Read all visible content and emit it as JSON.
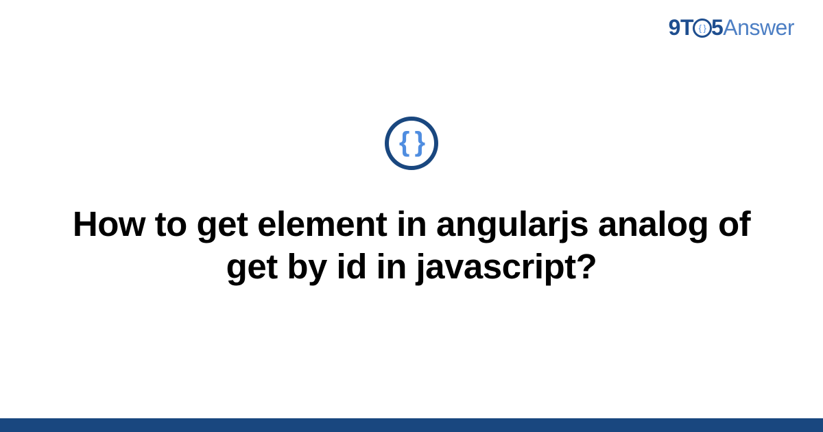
{
  "logo": {
    "part_9t": "9T",
    "circle_inner": "{ }",
    "part_5": "5",
    "part_answer": "Answer"
  },
  "category": {
    "icon_glyph": "{ }",
    "icon_name": "code-braces"
  },
  "title": "How to get element in angularjs analog of get by id in javascript?"
}
